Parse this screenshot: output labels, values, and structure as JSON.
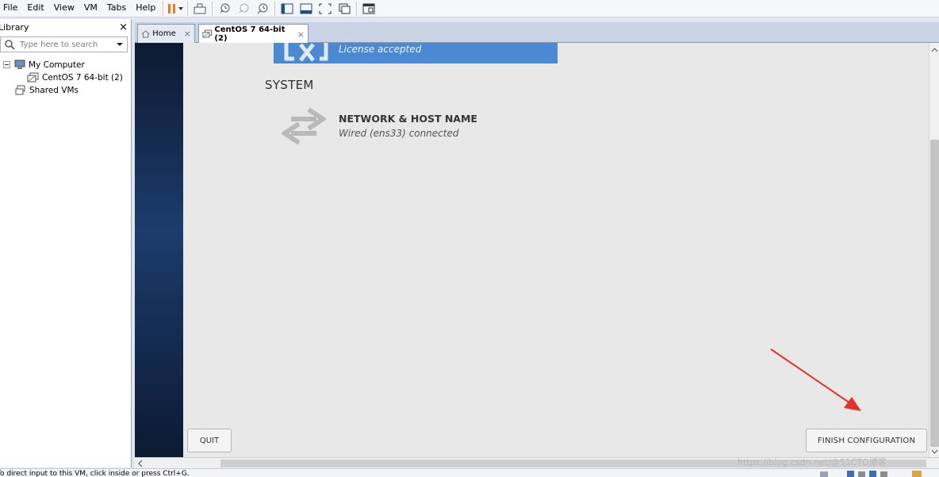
{
  "menubar": {
    "items": [
      "File",
      "Edit",
      "View",
      "VM",
      "Tabs",
      "Help"
    ]
  },
  "library": {
    "title": "Library",
    "close": "×",
    "search_placeholder": "Type here to search",
    "tree": {
      "my_computer": "My Computer",
      "vm_name": "CentOS 7 64-bit (2)",
      "shared_vms": "Shared VMs"
    }
  },
  "tabs": [
    {
      "label": "Home",
      "close": "×"
    },
    {
      "label": "CentOS 7 64-bit (2)",
      "close": "×"
    }
  ],
  "installer": {
    "license_text": "License accepted",
    "system_heading": "SYSTEM",
    "network_title": "NETWORK & HOST NAME",
    "network_status": "Wired (ens33) connected",
    "quit_label": "QUIT",
    "finish_label": "FINISH CONFIGURATION"
  },
  "statusbar": {
    "message": "To direct input to this VM, click inside or press Ctrl+G."
  },
  "watermark": "https://blog.csdn.net/@51CTO博客",
  "colors": {
    "license_bar": "#4b8ad3",
    "annotation_arrow": "#e8302a"
  }
}
